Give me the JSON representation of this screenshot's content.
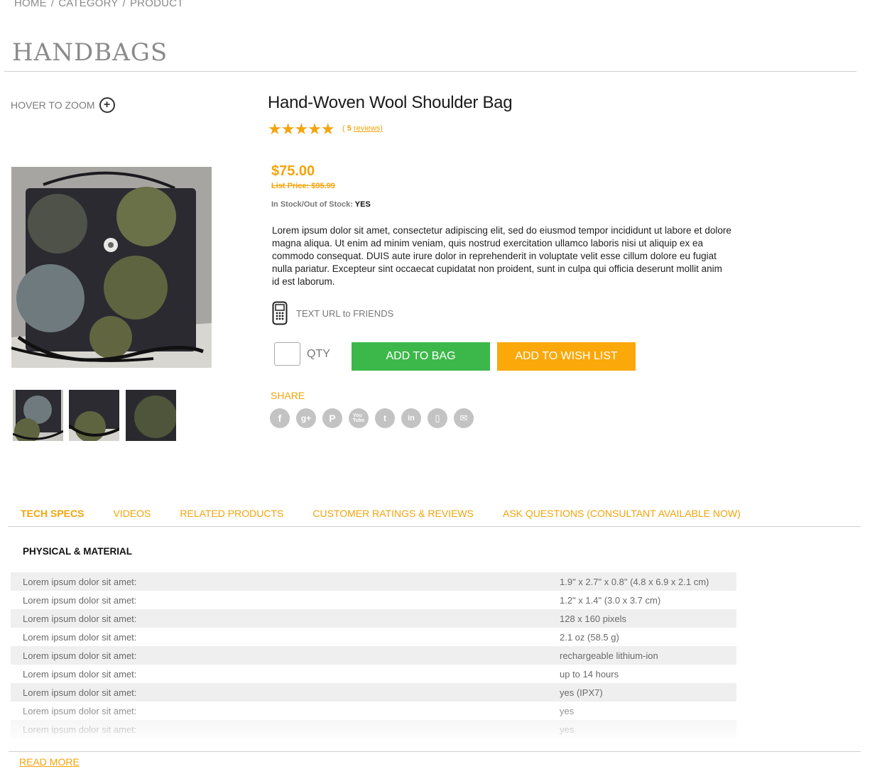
{
  "breadcrumb": {
    "home": "HOME",
    "category": "CATEGORY",
    "product": "PRODUCT",
    "separator": "/"
  },
  "page_title": "HANDBAGS",
  "zoom": {
    "label": "HOVER TO ZOOM",
    "icon": "plus-circle-icon"
  },
  "product": {
    "name": "Hand-Woven Wool Shoulder Bag",
    "stars": "★★★★★",
    "rating": 5,
    "reviews_open": "(",
    "reviews_count": "5",
    "reviews_label": "reviews)",
    "price": "$75.00",
    "list_price": "List Price: $95.99",
    "stock_label": "In Stock/Out of Stock:",
    "stock_value": "YES",
    "description": "Lorem ipsum dolor sit amet, consectetur adipiscing elit, sed do eiusmod tempor incididunt ut labore et dolore magna aliqua. Ut enim ad minim veniam, quis nostrud exercitation ullamco laboris nisi ut aliquip ex ea commodo consequat. DUIS aute irure dolor in reprehenderit in voluptate velit esse cillum dolore eu fugiat nulla pariatur. Excepteur sint occaecat cupidatat non proident, sunt in culpa qui officia deserunt mollit anim id est laborum."
  },
  "text_url": {
    "label": "TEXT URL to FRIENDS",
    "icon": "mobile-phone-icon"
  },
  "purchase": {
    "qty_label": "QTY",
    "qty_value": "",
    "add_to_bag": "ADD TO BAG",
    "add_to_wishlist": "ADD TO WISH LIST",
    "colors": {
      "bag": "#3cb84a",
      "wishlist": "#fba80a"
    }
  },
  "share": {
    "label": "SHARE",
    "icons": [
      "facebook-icon",
      "google-plus-icon",
      "pinterest-icon",
      "youtube-icon",
      "twitter-icon",
      "linkedin-icon",
      "mobile-icon",
      "email-icon"
    ]
  },
  "tabs": [
    {
      "label": "TECH SPECS",
      "active": true
    },
    {
      "label": "VIDEOS",
      "active": false
    },
    {
      "label": "RELATED PRODUCTS",
      "active": false
    },
    {
      "label": "CUSTOMER RATINGS & REVIEWS",
      "active": false
    },
    {
      "label": "ASK QUESTIONS (CONSULTANT AVAILABLE NOW)",
      "active": false
    }
  ],
  "specs": {
    "heading": "PHYSICAL & MATERIAL",
    "rows": [
      {
        "key": "Lorem ipsum dolor sit amet:",
        "value": "1.9\" x 2.7\" x 0.8\" (4.8 x 6.9 x 2.1 cm)"
      },
      {
        "key": "Lorem ipsum dolor sit amet:",
        "value": "1.2\" x 1.4\" (3.0 x 3.7 cm)"
      },
      {
        "key": "Lorem ipsum dolor sit amet:",
        "value": "128 x 160 pixels"
      },
      {
        "key": "Lorem ipsum dolor sit amet:",
        "value": "2.1 oz (58.5 g)"
      },
      {
        "key": "Lorem ipsum dolor sit amet:",
        "value": "rechargeable lithium-ion"
      },
      {
        "key": "Lorem ipsum dolor sit amet:",
        "value": "up to 14 hours"
      },
      {
        "key": "Lorem ipsum dolor sit amet:",
        "value": "yes (IPX7)"
      },
      {
        "key": "Lorem ipsum dolor sit amet:",
        "value": "yes"
      },
      {
        "key": "Lorem ipsum dolor sit amet:",
        "value": "yes"
      }
    ]
  },
  "read_more": "READ MORE",
  "accent_color": "#f4a40c"
}
